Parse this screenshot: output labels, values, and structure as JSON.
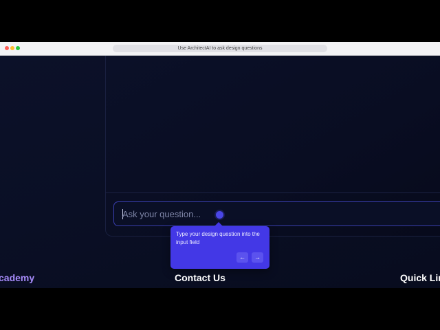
{
  "browser": {
    "url_text": "Use ArchitectAI to ask design questions"
  },
  "chat": {
    "input_placeholder": "Ask your question..."
  },
  "tour": {
    "tooltip_text": "Type your design question into the input field",
    "prev_icon": "arrow-left",
    "next_icon": "arrow-right",
    "accent": "#4338e6"
  },
  "footer": {
    "brand_partial": "cademy",
    "contact": "Contact Us",
    "quick_links_partial": "Quick Lin"
  },
  "colors": {
    "background": "#0a0e22",
    "brand_purple": "#a78bfa"
  }
}
